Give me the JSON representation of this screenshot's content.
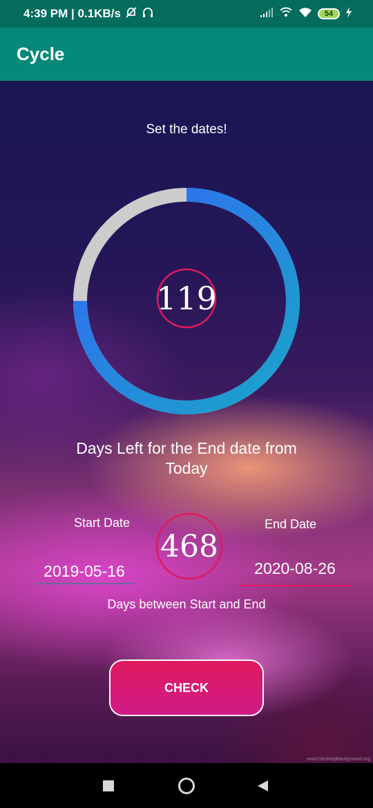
{
  "status_bar": {
    "time_speed": "4:39 PM | 0.1KB/s",
    "battery": "54",
    "icons": [
      "mute-bell-icon",
      "headset-icon",
      "signal-icon",
      "wifi-calling-icon",
      "wifi-icon",
      "battery-icon",
      "charging-icon"
    ]
  },
  "app_bar": {
    "title": "Cycle"
  },
  "main": {
    "heading": "Set the dates!",
    "days_left": "119",
    "days_left_label": "Days Left for the End date from Today",
    "progress": {
      "elapsed_fraction": 0.75
    },
    "start_label": "Start Date",
    "start_value": "2019-05-16",
    "end_label": "End Date",
    "end_value": "2020-08-26",
    "days_between": "468",
    "days_between_label": "Days between Start and End",
    "check_button": "CHECK",
    "watermark": "www.DesktopBackground.org"
  },
  "colors": {
    "status_bar": "#046c5c",
    "app_bar": "#07897a",
    "ring_track": "#cccccc",
    "ring_start": "#1aa6c9",
    "ring_end": "#3366f5",
    "accent": "#e0195d",
    "button": "#d81b6e"
  },
  "nav": {
    "icons": [
      "recents-square-icon",
      "home-circle-icon",
      "back-triangle-icon"
    ]
  }
}
